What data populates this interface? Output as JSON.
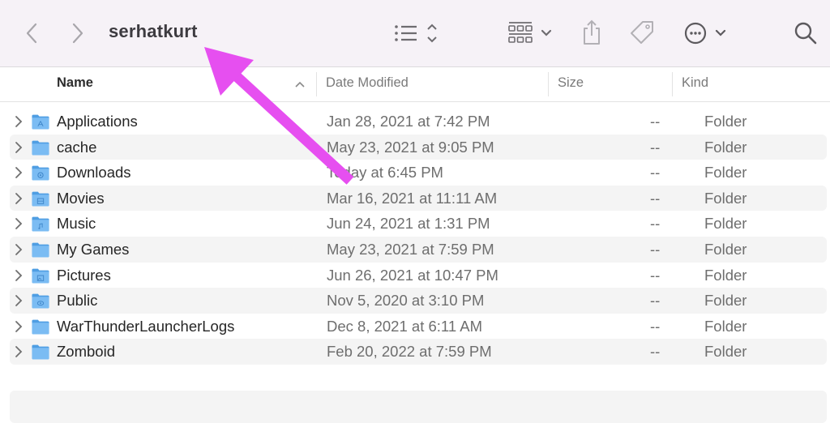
{
  "toolbar": {
    "title": "serhatkurt",
    "back_icon": "chevron-left-icon",
    "forward_icon": "chevron-right-icon",
    "view_icon": "list-view-icon",
    "group_icon": "grid-group-icon",
    "share_icon": "share-icon",
    "tag_icon": "tag-icon",
    "more_icon": "ellipsis-circle-icon",
    "search_icon": "search-icon"
  },
  "columns": {
    "name": "Name",
    "date_modified": "Date Modified",
    "size": "Size",
    "kind": "Kind",
    "sort": "ascending"
  },
  "files": [
    {
      "name": "Applications",
      "date": "Jan 28, 2021 at 7:42 PM",
      "size": "--",
      "kind": "Folder",
      "icon": "applications"
    },
    {
      "name": "cache",
      "date": "May 23, 2021 at 9:05 PM",
      "size": "--",
      "kind": "Folder",
      "icon": "plain"
    },
    {
      "name": "Downloads",
      "date": "Today at 6:45 PM",
      "size": "--",
      "kind": "Folder",
      "icon": "downloads"
    },
    {
      "name": "Movies",
      "date": "Mar 16, 2021 at 11:11 AM",
      "size": "--",
      "kind": "Folder",
      "icon": "movies"
    },
    {
      "name": "Music",
      "date": "Jun 24, 2021 at 1:31 PM",
      "size": "--",
      "kind": "Folder",
      "icon": "music"
    },
    {
      "name": "My Games",
      "date": "May 23, 2021 at 7:59 PM",
      "size": "--",
      "kind": "Folder",
      "icon": "plain"
    },
    {
      "name": "Pictures",
      "date": "Jun 26, 2021 at 10:47 PM",
      "size": "--",
      "kind": "Folder",
      "icon": "pictures"
    },
    {
      "name": "Public",
      "date": "Nov 5, 2020 at 3:10 PM",
      "size": "--",
      "kind": "Folder",
      "icon": "public"
    },
    {
      "name": "WarThunderLauncherLogs",
      "date": "Dec 8, 2021 at 6:11 AM",
      "size": "--",
      "kind": "Folder",
      "icon": "plain"
    },
    {
      "name": "Zomboid",
      "date": "Feb 20, 2022 at 7:59 PM",
      "size": "--",
      "kind": "Folder",
      "icon": "plain"
    }
  ],
  "annotation": {
    "type": "arrow",
    "color": "#e64ff0",
    "points_to": "serhatkurt"
  }
}
